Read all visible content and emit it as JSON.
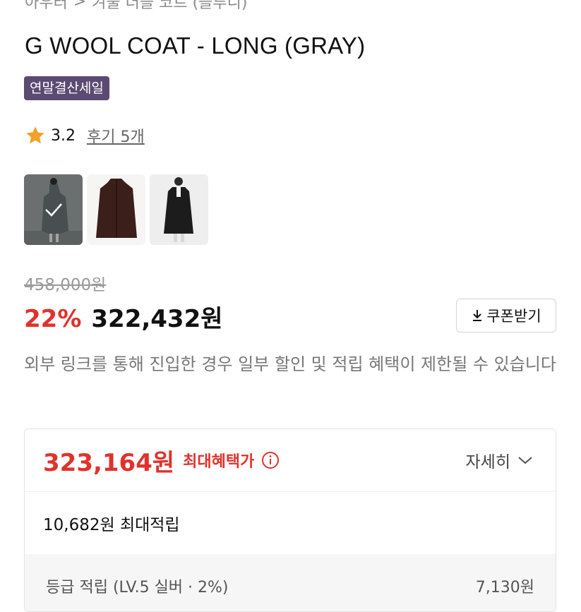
{
  "breadcrumb": {
    "category": "아우터",
    "separator": ">",
    "subcategory": "겨울 더블 코트 (블루니)"
  },
  "product": {
    "title": "G WOOL COAT - LONG (GRAY)",
    "sale_badge": "연말결산세일",
    "rating": "3.2",
    "reviews_link": "후기 5개",
    "thumbnails": [
      "gray-coat-model",
      "brown-coat",
      "black-coat-model"
    ]
  },
  "price": {
    "original": "458,000원",
    "discount_rate": "22%",
    "final": "322,432원",
    "coupon_label": "쿠폰받기"
  },
  "notice": "외부 링크를 통해 진입한 경우 일부 할인 및 적립 혜택이 제한될 수 있습니다",
  "benefit": {
    "max_price": "323,164원",
    "max_label": "최대혜택가",
    "details_label": "자세히",
    "accrual_text": "10,682원 최대적립",
    "level_text": "등급 적립 (LV.5 실버 · 2%)",
    "level_amount": "7,130원"
  },
  "colors": {
    "accent_red": "#e0322c",
    "badge_purple": "#5b4a72",
    "star": "#f2a12b"
  },
  "icons": {
    "rating": "star-icon",
    "coupon": "download-icon",
    "info": "info-icon",
    "details": "chevron-down-icon",
    "thumb_selected": "check-icon"
  }
}
